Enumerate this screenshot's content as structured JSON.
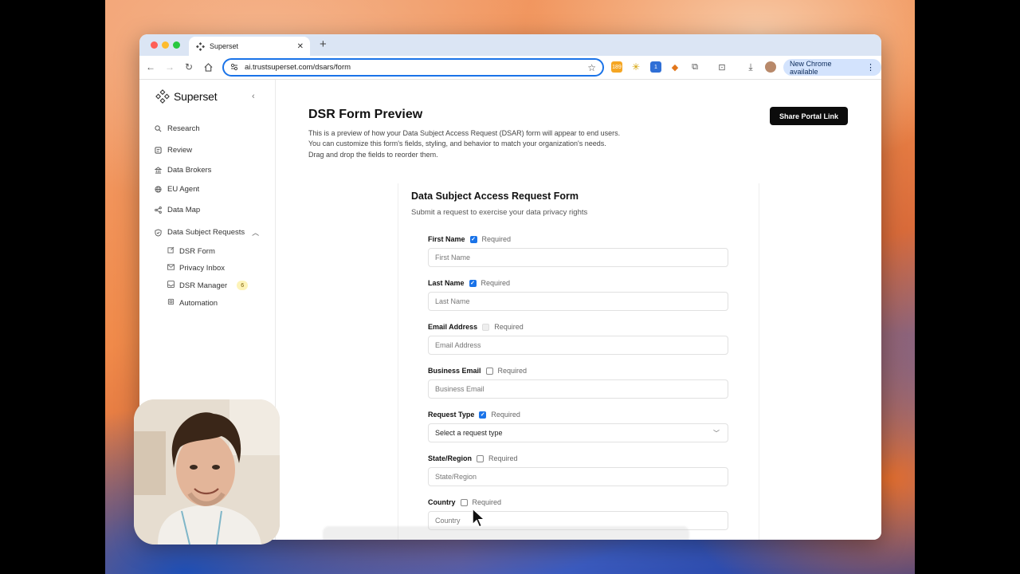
{
  "browser": {
    "tab_title": "Superset",
    "url": "ai.trustsuperset.com/dsars/form",
    "ext_badge_1": "189",
    "ext_badge_3": "1",
    "update_label": "New Chrome available"
  },
  "sidebar": {
    "logo_text": "Superset",
    "items": [
      {
        "label": "Research",
        "icon": "search-icon"
      },
      {
        "label": "Review",
        "icon": "review-icon"
      },
      {
        "label": "Data Brokers",
        "icon": "bank-icon"
      },
      {
        "label": "EU Agent",
        "icon": "globe-icon"
      },
      {
        "label": "Data Map",
        "icon": "share-icon"
      },
      {
        "label": "Data Subject Requests",
        "icon": "shield-icon"
      }
    ],
    "sub_items": [
      {
        "label": "DSR Form",
        "icon": "edit-icon"
      },
      {
        "label": "Privacy Inbox",
        "icon": "mail-icon"
      },
      {
        "label": "DSR Manager",
        "icon": "inbox-icon",
        "badge": "6"
      },
      {
        "label": "Automation",
        "icon": "chip-icon"
      }
    ]
  },
  "main": {
    "title": "DSR Form Preview",
    "desc_1": "This is a preview of how your Data Subject Access Request (DSAR) form will appear to end users.",
    "desc_2": "You can customize this form's fields, styling, and behavior to match your organization's needs.",
    "desc_3": "Drag and drop the fields to reorder them.",
    "share_label": "Share Portal Link"
  },
  "form": {
    "title": "Data Subject Access Request Form",
    "subtitle": "Submit a request to exercise your data privacy rights",
    "required_label": "Required",
    "fields": [
      {
        "label": "First Name",
        "placeholder": "First Name",
        "required": true
      },
      {
        "label": "Last Name",
        "placeholder": "Last Name",
        "required": true
      },
      {
        "label": "Email Address",
        "placeholder": "Email Address",
        "required": "disabled"
      },
      {
        "label": "Business Email",
        "placeholder": "Business Email",
        "required": false
      },
      {
        "label": "Request Type",
        "placeholder": "Select a request type",
        "required": true
      },
      {
        "label": "State/Region",
        "placeholder": "State/Region",
        "required": false
      },
      {
        "label": "Country",
        "placeholder": "Country",
        "required": false
      }
    ]
  },
  "colors": {
    "accent": "#1a73e8",
    "button_bg": "#0c0c0c",
    "badge_bg": "#fdf3b8"
  }
}
